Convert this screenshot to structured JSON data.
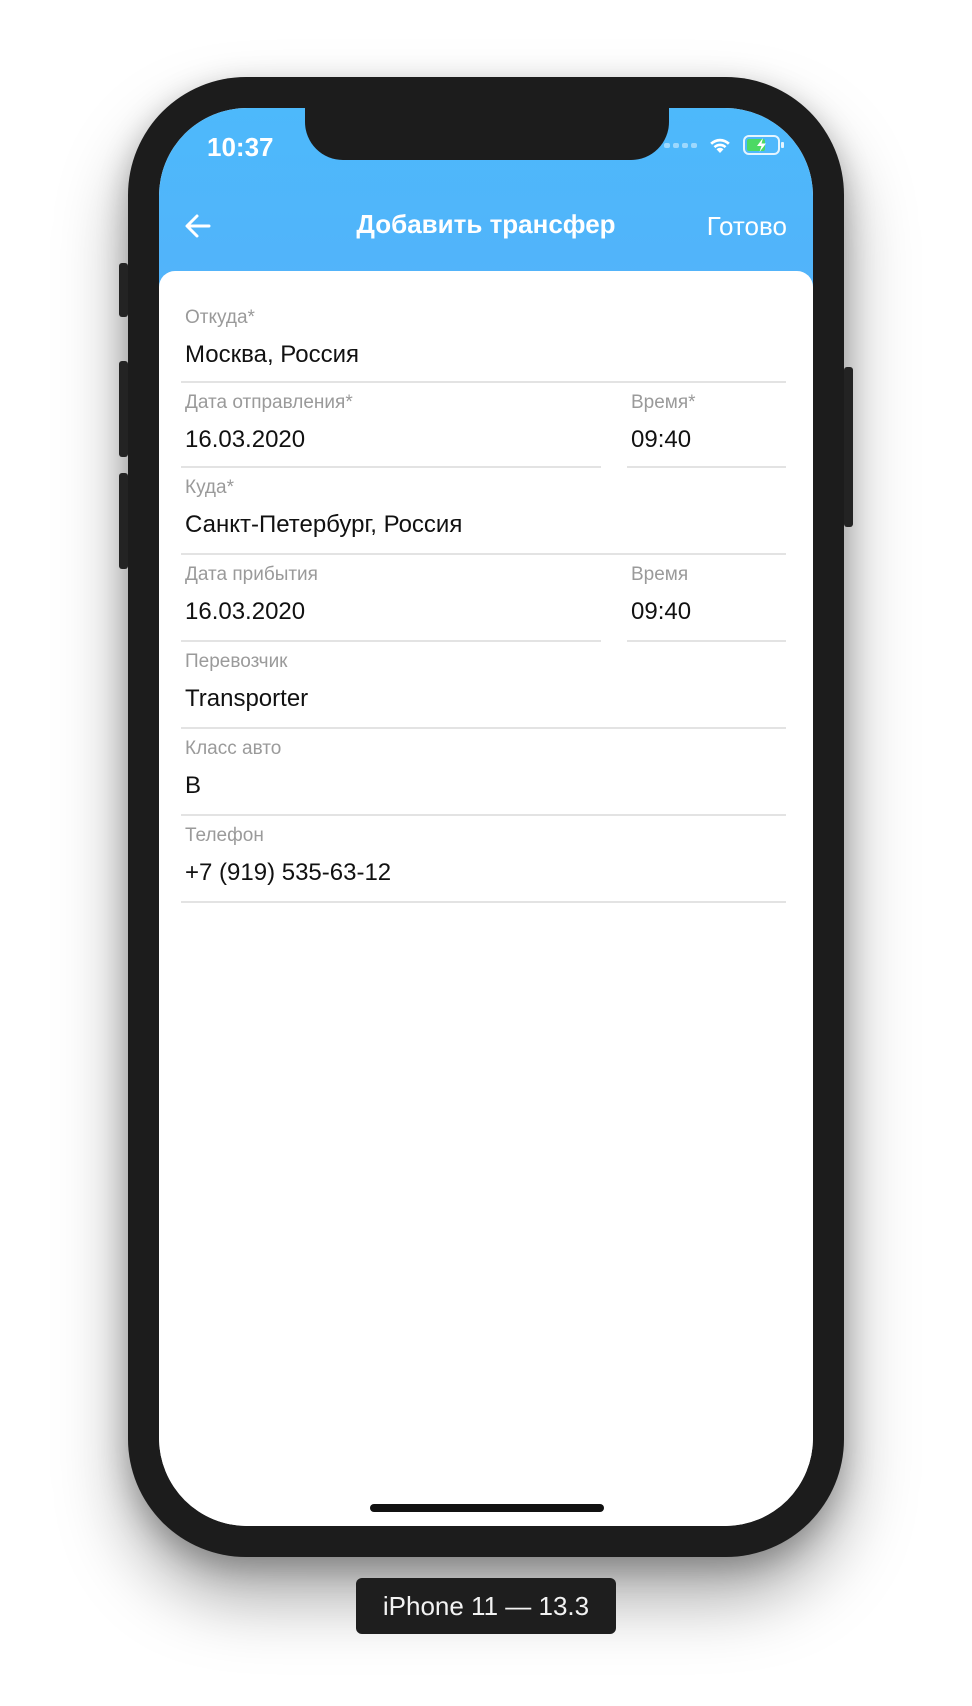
{
  "status_bar": {
    "time": "10:37"
  },
  "nav": {
    "back_icon": "arrow-left-icon",
    "title": "Добавить трансфер",
    "done_label": "Готово"
  },
  "form": {
    "from": {
      "label": "Откуда*",
      "value": "Москва, Россия"
    },
    "departure_date": {
      "label": "Дата отправления*",
      "value": "16.03.2020"
    },
    "departure_time": {
      "label": "Время*",
      "value": "09:40"
    },
    "to": {
      "label": "Куда*",
      "value": "Санкт-Петербург, Россия"
    },
    "arrival_date": {
      "label": "Дата прибытия",
      "value": "16.03.2020"
    },
    "arrival_time": {
      "label": "Время",
      "value": "09:40"
    },
    "carrier": {
      "label": "Перевозчик",
      "value": "Transporter"
    },
    "car_class": {
      "label": "Класс авто",
      "value": "B"
    },
    "phone": {
      "label": "Телефон",
      "value": "+7 (919) 535-63-12"
    }
  },
  "device_caption": "iPhone 11 — 13.3",
  "colors": {
    "header_blue": "#4db9fb",
    "label_gray": "#9a9a9a",
    "divider": "#e3e3e3",
    "battery_green": "#4cd964"
  }
}
